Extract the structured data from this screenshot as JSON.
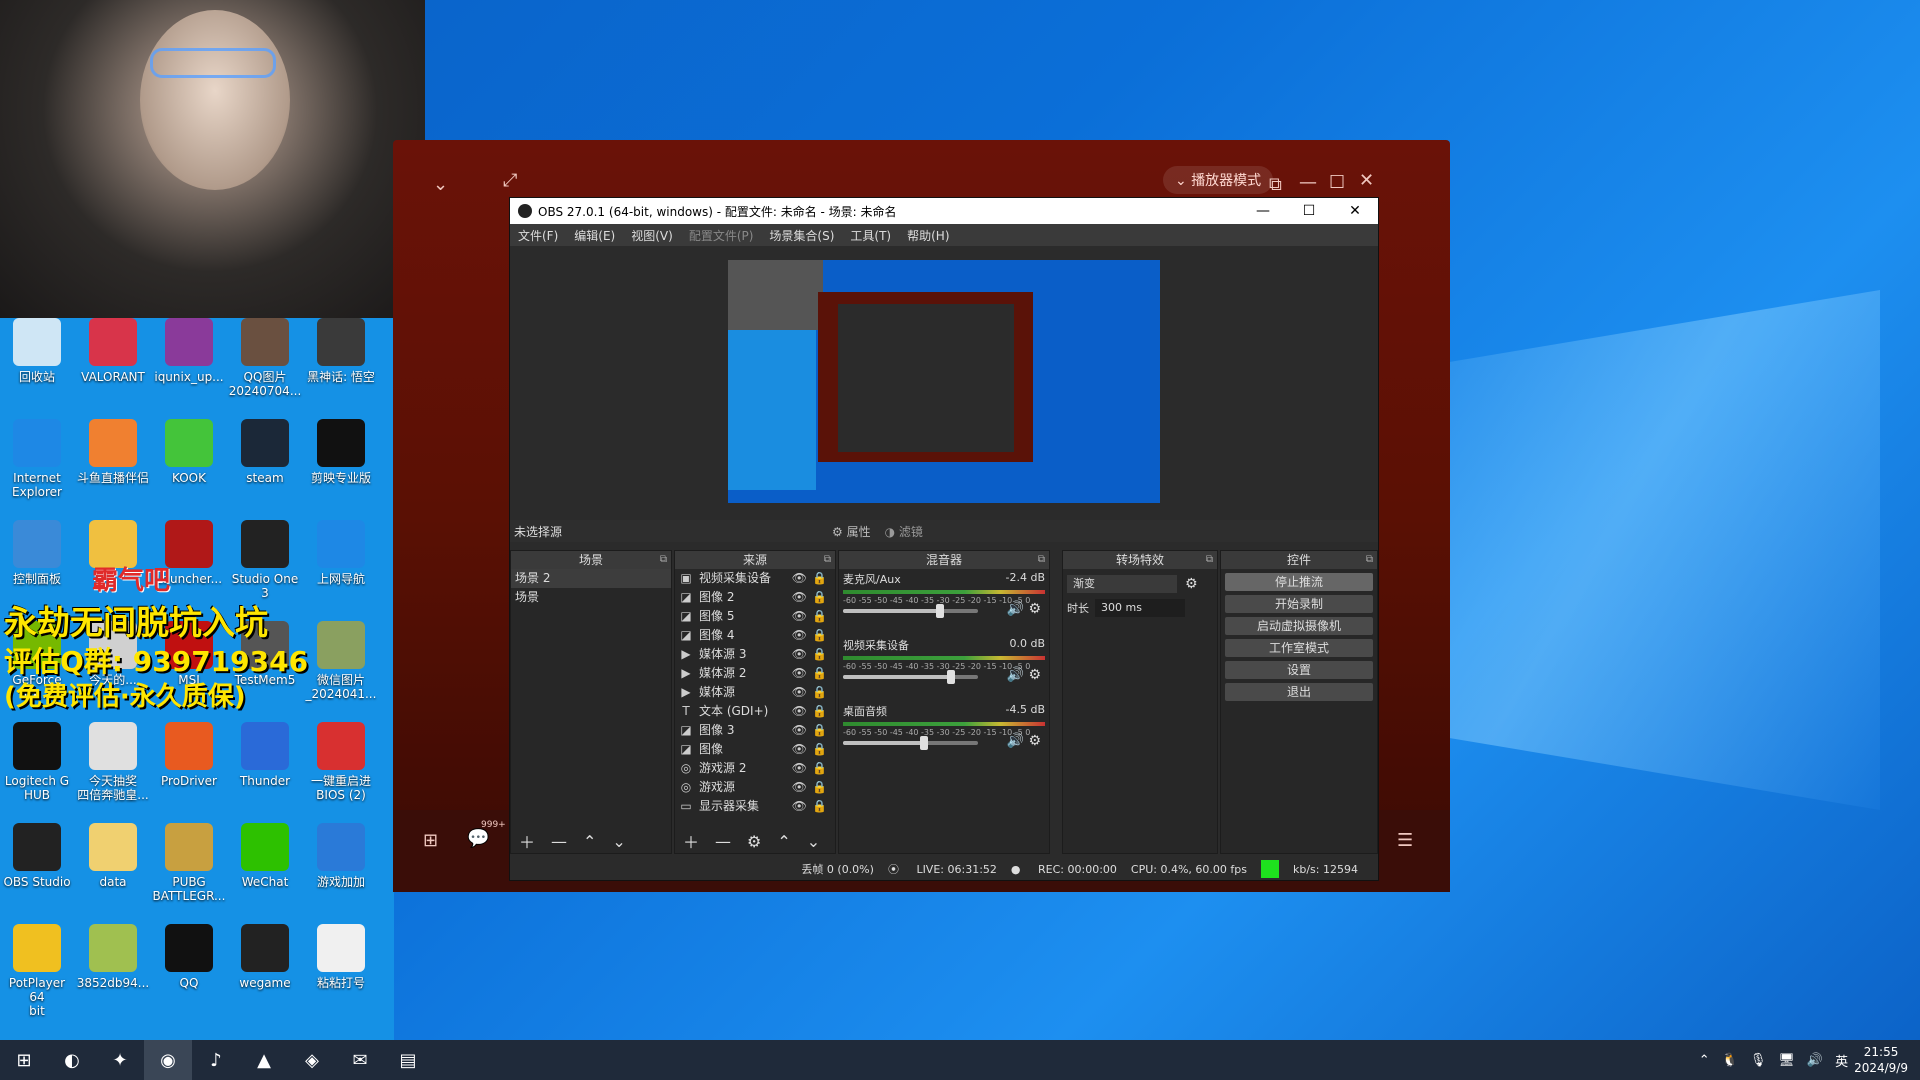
{
  "desktop": {
    "icons": [
      {
        "label": "回收站",
        "icon": "recycle-bin-icon",
        "color": "#cfe6f5"
      },
      {
        "label": "VALORANT",
        "icon": "valorant-icon",
        "color": "#d8344a"
      },
      {
        "label": "iqunix_up...",
        "icon": "archive-icon",
        "color": "#8a3a9a"
      },
      {
        "label": "QQ图片\n20240704...",
        "icon": "image-icon",
        "color": "#6a5040"
      },
      {
        "label": "黑神话: 悟空",
        "icon": "wukong-icon",
        "color": "#3a3a3a"
      },
      {
        "label": "Internet\nExplorer",
        "icon": "ie-icon",
        "color": "#1e88e5"
      },
      {
        "label": "斗鱼直播伴侣",
        "icon": "douyu-icon",
        "color": "#f08030"
      },
      {
        "label": "KOOK",
        "icon": "kook-icon",
        "color": "#44c43a"
      },
      {
        "label": "steam",
        "icon": "steam-icon",
        "color": "#1b2838"
      },
      {
        "label": "剪映专业版",
        "icon": "capcut-icon",
        "color": "#111111"
      },
      {
        "label": "控制面板",
        "icon": "control-panel-icon",
        "color": "#3a8ad8"
      },
      {
        "label": "",
        "icon": "folder-icon",
        "color": "#f0c040"
      },
      {
        "label": "Launcher...",
        "icon": "naraka-icon",
        "color": "#b01818"
      },
      {
        "label": "Studio One\n3",
        "icon": "studio-one-icon",
        "color": "#222222"
      },
      {
        "label": "上网导航",
        "icon": "browser-nav-icon",
        "color": "#1e88e5"
      },
      {
        "label": "GeForce\nEx...",
        "icon": "geforce-icon",
        "color": "#76b900"
      },
      {
        "label": "今天的...",
        "icon": "doc-icon",
        "color": "#d0d0d0"
      },
      {
        "label": "MSI",
        "icon": "msi-icon",
        "color": "#c01010"
      },
      {
        "label": "TestMem5",
        "icon": "testmem-icon",
        "color": "#555555"
      },
      {
        "label": "微信图片\n_2024041...",
        "icon": "image-icon",
        "color": "#8aa060"
      },
      {
        "label": "Logitech G\nHUB",
        "icon": "logitech-icon",
        "color": "#111111"
      },
      {
        "label": "今天抽奖\n四倍奔驰皇...",
        "icon": "image-icon",
        "color": "#e0e0e0"
      },
      {
        "label": "ProDriver",
        "icon": "icon-brand-icon",
        "color": "#e85a20"
      },
      {
        "label": "Thunder",
        "icon": "thunder-icon",
        "color": "#2a6ad8"
      },
      {
        "label": "一键重启进\nBIOS (2)",
        "icon": "power-icon",
        "color": "#d83030"
      },
      {
        "label": "OBS Studio",
        "icon": "obs-icon",
        "color": "#222222"
      },
      {
        "label": "data",
        "icon": "folder-icon",
        "color": "#f0d070"
      },
      {
        "label": "PUBG\nBATTLEGR...",
        "icon": "pubg-icon",
        "color": "#c8a040"
      },
      {
        "label": "WeChat",
        "icon": "wechat-icon",
        "color": "#2dc100"
      },
      {
        "label": "游戏加加",
        "icon": "game-plus-icon",
        "color": "#2a7ad8"
      },
      {
        "label": "PotPlayer 64\nbit",
        "icon": "potplayer-icon",
        "color": "#f0c020"
      },
      {
        "label": "3852db94...",
        "icon": "image-icon",
        "color": "#a0c050"
      },
      {
        "label": "QQ",
        "icon": "qq-icon",
        "color": "#111111"
      },
      {
        "label": "wegame",
        "icon": "wegame-icon",
        "color": "#222222"
      },
      {
        "label": "粘粘打号",
        "icon": "text-file-icon",
        "color": "#f0f0f0"
      }
    ],
    "overlay": {
      "red_text": "霸气吧",
      "title": "永劫无间脱坑入坑",
      "qq_group": "评估Q群: 939719346",
      "free_note": "(免费评估·永久质保)"
    }
  },
  "player": {
    "mode_button": "播放器模式",
    "badge": "999+"
  },
  "obs": {
    "title": "OBS 27.0.1 (64-bit, windows) - 配置文件: 未命名 - 场景: 未命名",
    "menu": [
      "文件(F)",
      "编辑(E)",
      "视图(V)",
      "配置文件(P)",
      "场景集合(S)",
      "工具(T)",
      "帮助(H)"
    ],
    "no_source": "未选择源",
    "properties": "属性",
    "filters": "滤镜",
    "scenes_header": "场景",
    "scenes": [
      "场景 2",
      "场景"
    ],
    "sources_header": "来源",
    "sources": [
      {
        "name": "视频采集设备",
        "icon": "camera-icon"
      },
      {
        "name": "图像 2",
        "icon": "image-icon"
      },
      {
        "name": "图像 5",
        "icon": "image-icon"
      },
      {
        "name": "图像 4",
        "icon": "image-icon"
      },
      {
        "name": "媒体源 3",
        "icon": "play-icon"
      },
      {
        "name": "媒体源 2",
        "icon": "play-icon"
      },
      {
        "name": "媒体源",
        "icon": "play-icon"
      },
      {
        "name": "文本 (GDI+)",
        "icon": "text-icon"
      },
      {
        "name": "图像 3",
        "icon": "image-icon"
      },
      {
        "name": "图像",
        "icon": "image-icon"
      },
      {
        "name": "游戏源 2",
        "icon": "gamepad-icon"
      },
      {
        "name": "游戏源",
        "icon": "gamepad-icon"
      },
      {
        "name": "显示器采集",
        "icon": "monitor-icon"
      }
    ],
    "mixer_header": "混音器",
    "mixer": [
      {
        "name": "麦克风/Aux",
        "db": "-2.4 dB",
        "volume": 0.72
      },
      {
        "name": "视频采集设备",
        "db": "0.0 dB",
        "volume": 0.8
      },
      {
        "name": "桌面音频",
        "db": "-4.5 dB",
        "volume": 0.6
      }
    ],
    "meter_ticks": "-60 -55 -50 -45 -40 -35 -30 -25 -20 -15 -10 -5 0",
    "transitions_header": "转场特效",
    "transition": "渐变",
    "duration_label": "时长",
    "duration": "300 ms",
    "controls_header": "控件",
    "controls": [
      "停止推流",
      "开始录制",
      "启动虚拟摄像机",
      "工作室模式",
      "设置",
      "退出"
    ],
    "status": {
      "dropped": "丢帧 0 (0.0%)",
      "live": "LIVE: 06:31:52",
      "rec": "REC: 00:00:00",
      "cpu": "CPU: 0.4%, 60.00 fps",
      "kbs": "kb/s: 12594"
    }
  },
  "taskbar": {
    "apps": [
      "start-icon",
      "edge-icon",
      "kook-icon",
      "obs-icon",
      "netease-music-icon",
      "naraka-icon",
      "wegame-icon",
      "wechat-icon",
      "explorer-icon"
    ],
    "ime": "英",
    "time": "21:55",
    "date": "2024/9/9"
  }
}
